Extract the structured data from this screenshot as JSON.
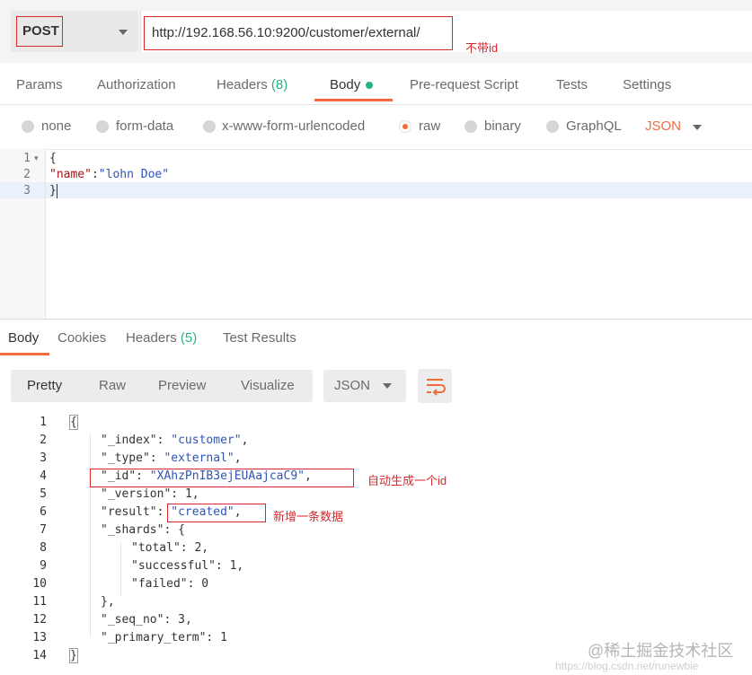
{
  "request": {
    "method": "POST",
    "url": "http://192.168.56.10:9200/customer/external/",
    "annotation": "不带id"
  },
  "request_tabs": {
    "params": "Params",
    "authorization": "Authorization",
    "headers": "Headers",
    "headers_count": "(8)",
    "body": "Body",
    "pre_request": "Pre-request Script",
    "tests": "Tests",
    "settings": "Settings"
  },
  "body_types": {
    "none": "none",
    "form_data": "form-data",
    "urlencoded": "x-www-form-urlencoded",
    "raw": "raw",
    "binary": "binary",
    "graphql": "GraphQL",
    "format": "JSON"
  },
  "request_body": {
    "line_numbers": [
      "1",
      "2",
      "3"
    ],
    "line1": "{",
    "line2_key": "\"name\"",
    "line2_colon": ":",
    "line2_value": "\"lohn Doe\"",
    "line3": "}"
  },
  "response_tabs": {
    "body": "Body",
    "cookies": "Cookies",
    "headers": "Headers",
    "headers_count": "(5)",
    "test_results": "Test Results"
  },
  "response_view": {
    "pretty": "Pretty",
    "raw": "Raw",
    "preview": "Preview",
    "visualize": "Visualize",
    "format": "JSON"
  },
  "response_body": {
    "line_numbers": [
      "1",
      "2",
      "3",
      "4",
      "5",
      "6",
      "7",
      "8",
      "9",
      "10",
      "11",
      "12",
      "13",
      "14"
    ],
    "l1": "{",
    "l2_key": "\"_index\"",
    "l2_val": "\"customer\"",
    "l3_key": "\"_type\"",
    "l3_val": "\"external\"",
    "l4_key": "\"_id\"",
    "l4_val": "\"XAhzPnIB3ejEUAajcaC9\"",
    "l5_key": "\"_version\"",
    "l5_val": "1",
    "l6_key": "\"result\"",
    "l6_val": "\"created\"",
    "l7_key": "\"_shards\"",
    "l7_val": "{",
    "l8_key": "\"total\"",
    "l8_val": "2",
    "l9_key": "\"successful\"",
    "l9_val": "1",
    "l10_key": "\"failed\"",
    "l10_val": "0",
    "l11": "},",
    "l12_key": "\"_seq_no\"",
    "l12_val": "3",
    "l13_key": "\"_primary_term\"",
    "l13_val": "1",
    "l14": "}"
  },
  "annotations": {
    "id_note": "自动生成一个id",
    "result_note": "新增一条数据"
  },
  "watermark": {
    "main": "@稀土掘金技术社区",
    "sub": "https://blog.csdn.net/runewbie"
  },
  "colors": {
    "accent": "#f26b3a",
    "annotation_red": "#d9272e",
    "count_green": "#26b47f",
    "string_blue": "#2f54b8"
  }
}
